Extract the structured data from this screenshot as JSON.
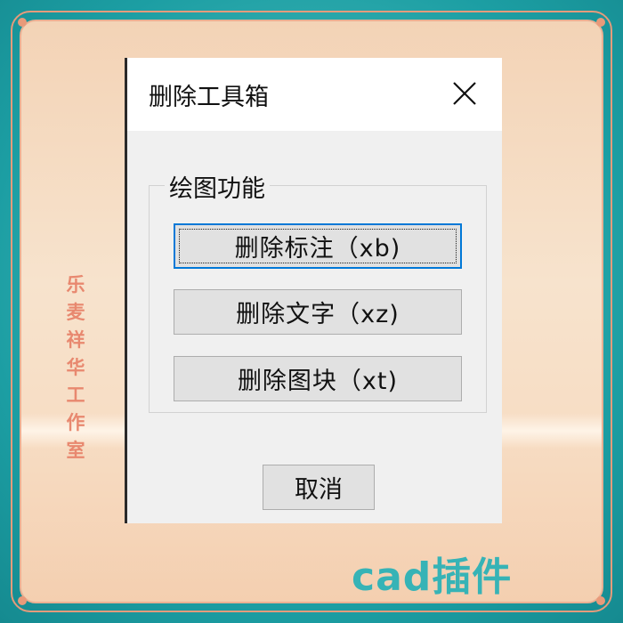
{
  "dialog": {
    "title": "删除工具箱",
    "group_label": "绘图功能",
    "buttons": [
      {
        "label": "删除标注（xb)"
      },
      {
        "label": "删除文字（xz)"
      },
      {
        "label": "删除图块（xt)"
      }
    ],
    "cancel_label": "取消"
  },
  "decor": {
    "side_text": [
      "乐",
      "麦",
      "祥",
      "华",
      "工",
      "作",
      "室"
    ],
    "brand_text": "cad插件"
  },
  "colors": {
    "frame_teal": "#1fa4a8",
    "frame_border": "#e59b7b",
    "side_text": "#e8886f",
    "brand_text": "#36b3b6",
    "focus_blue": "#0078d7"
  },
  "icons": {
    "close": "close-icon"
  }
}
